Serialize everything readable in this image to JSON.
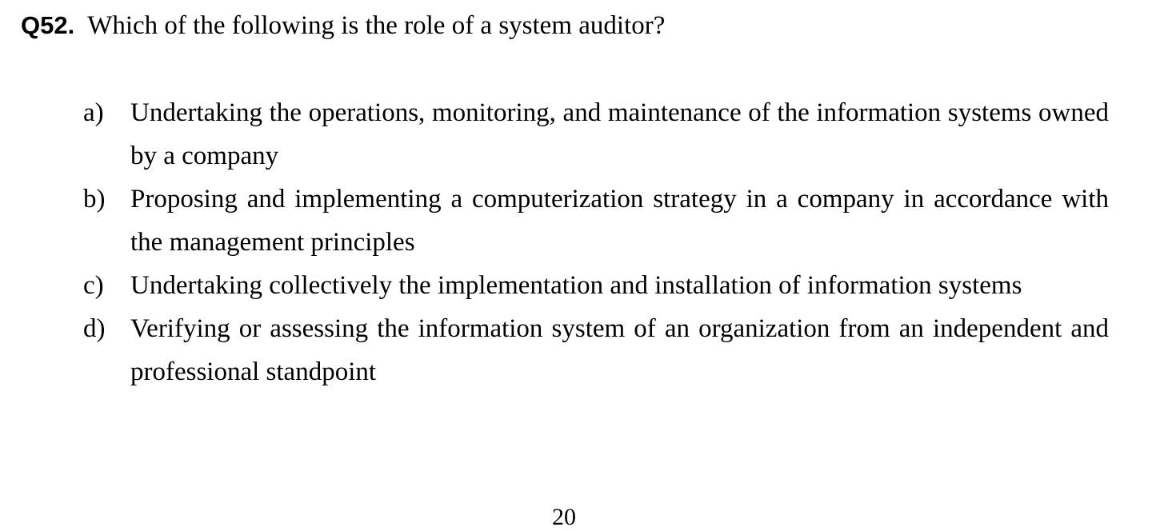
{
  "question": {
    "number": "Q52.",
    "text": "Which of the following is the role of a system auditor?"
  },
  "options": [
    {
      "letter": "a)",
      "text": "Undertaking the operations, monitoring, and maintenance of the information systems owned by a company"
    },
    {
      "letter": "b)",
      "text": "Proposing and implementing a computerization strategy in a company in accordance with the management principles"
    },
    {
      "letter": "c)",
      "text": "Undertaking collectively the implementation and installation of information systems"
    },
    {
      "letter": "d)",
      "text": "Verifying or assessing the information system of an organization from an independent and professional standpoint"
    }
  ],
  "page_number": "20"
}
